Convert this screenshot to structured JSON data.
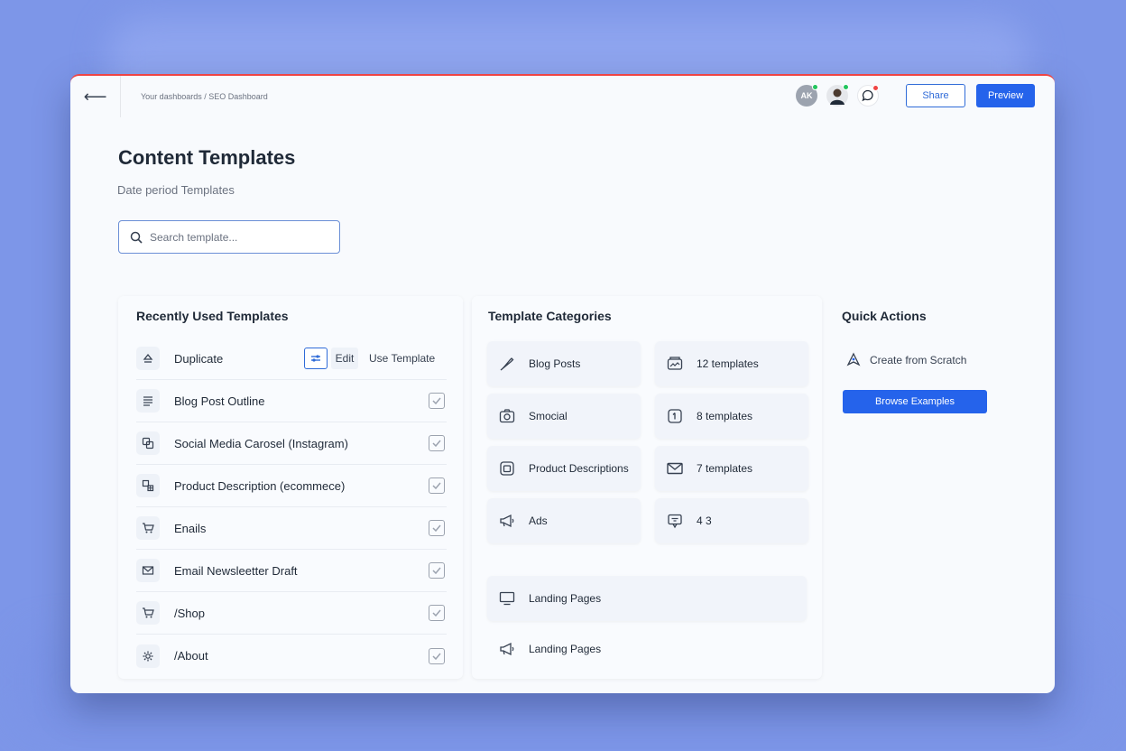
{
  "header": {
    "breadcrumb": "Your dashboards / SEO Dashboard",
    "avatar_initials": "AK",
    "share_label": "Share",
    "preview_label": "Preview"
  },
  "main": {
    "title": "Content Templates",
    "subtitle": "Date period Templates",
    "search_placeholder": "Search template..."
  },
  "recent": {
    "title": "Recently Used Templates",
    "first_row": {
      "label": "Duplicate",
      "edit_label": "Edit",
      "use_label": "Use Template"
    },
    "items": [
      {
        "label": "Blog Post Outline",
        "icon": "list-icon"
      },
      {
        "label": "Social Media Carosel (Instagram)",
        "icon": "carousel-icon"
      },
      {
        "label": "Product Description (ecommece)",
        "icon": "product-icon"
      },
      {
        "label": "Enails",
        "icon": "cart-icon"
      },
      {
        "label": "Email Newsleetter Draft",
        "icon": "mail-icon"
      },
      {
        "label": "/Shop",
        "icon": "cart-icon"
      },
      {
        "label": "/About",
        "icon": "gear-icon"
      }
    ]
  },
  "categories": {
    "title": "Template Categories",
    "cards": [
      {
        "label": "Blog Posts",
        "icon": "pen-icon"
      },
      {
        "label": "12 templates",
        "icon": "image-stack-icon"
      },
      {
        "label": "Smocial",
        "icon": "camera-icon"
      },
      {
        "label": "8 templates",
        "icon": "plus-square-icon"
      },
      {
        "label": "Product Descriptions",
        "icon": "box-icon"
      },
      {
        "label": "7 templates",
        "icon": "mail-icon"
      },
      {
        "label": "Ads",
        "icon": "megaphone-icon"
      },
      {
        "label": "4 3",
        "icon": "chat-icon"
      }
    ],
    "wide_cards": [
      {
        "label": "Landing Pages",
        "icon": "monitor-icon"
      },
      {
        "label": "Landing Pages",
        "icon": "megaphone-icon"
      }
    ]
  },
  "quick_actions": {
    "title": "Quick Actions",
    "create_label": "Create from Scratch",
    "browse_label": "Browse Examples"
  },
  "colors": {
    "accent": "#2563eb",
    "background": "#7d96e8",
    "top_border": "#ef4444"
  }
}
